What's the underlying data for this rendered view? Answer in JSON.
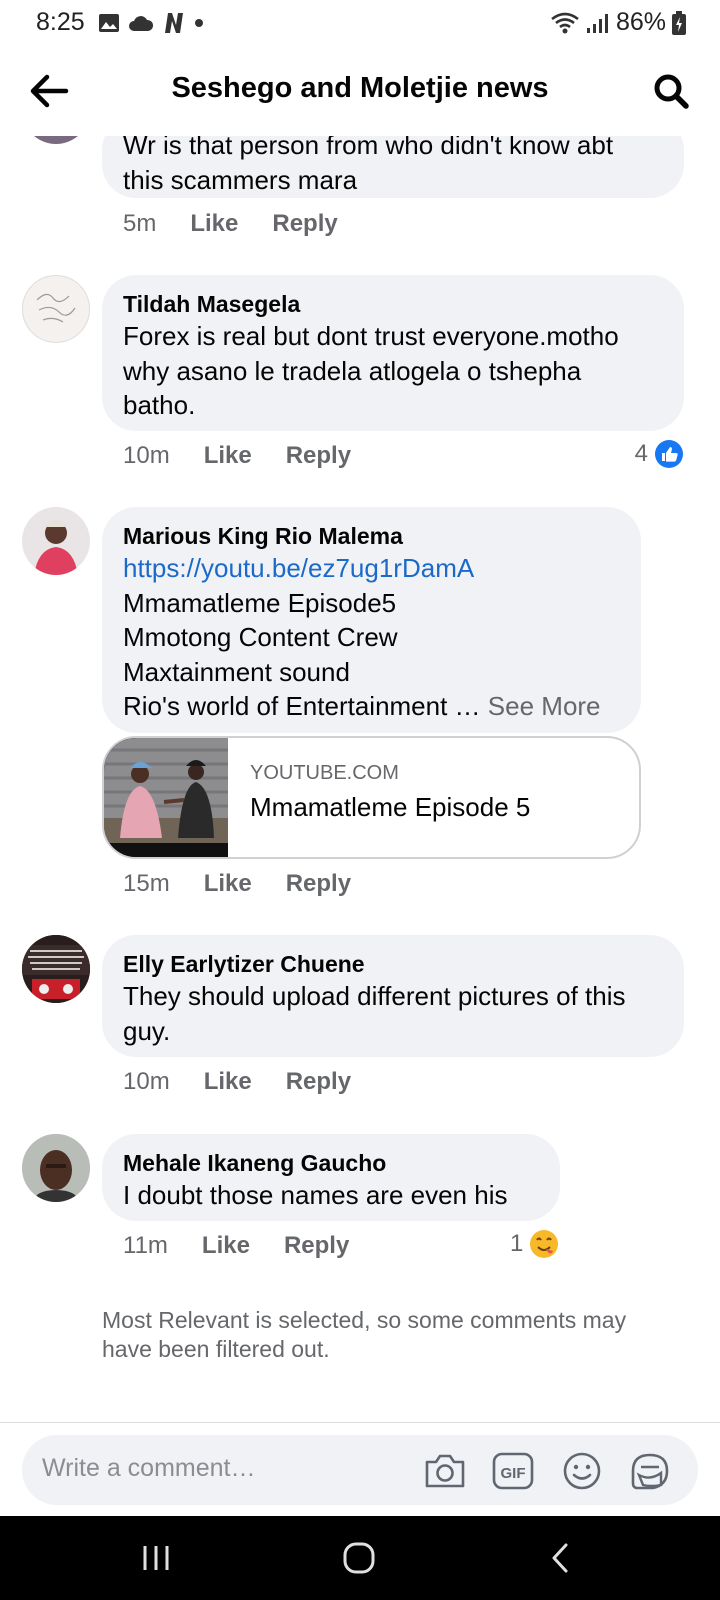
{
  "status_bar": {
    "time": "8:25",
    "battery": "86%"
  },
  "header": {
    "title": "Seshego and Moletjie news"
  },
  "comments": [
    {
      "author": "",
      "text": "Wr is that person from who didn't know abt\nthis scammers mara",
      "time": "5m",
      "like_label": "Like",
      "reply_label": "Reply"
    },
    {
      "author": "Tildah Masegela",
      "text": "Forex is real but dont trust everyone.motho\nwhy asano le tradela atlogela o tshepha\nbatho.",
      "time": "10m",
      "like_label": "Like",
      "reply_label": "Reply",
      "reaction_count": "4",
      "reaction_icon": "like-reaction-icon"
    },
    {
      "author": "Marious King Rio Malema",
      "link": "https://youtu.be/ez7ug1rDamA",
      "text": "Mmamatleme Episode5\nMmotong Content Crew\nMaxtainment sound\nRio's world of Entertainment …",
      "see_more": "See More",
      "link_card": {
        "domain": "YOUTUBE.COM",
        "title": "Mmamatleme Episode 5"
      },
      "time": "15m",
      "like_label": "Like",
      "reply_label": "Reply"
    },
    {
      "author": "Elly Earlytizer Chuene",
      "text": "They should upload different pictures of this\nguy.",
      "time": "10m",
      "like_label": "Like",
      "reply_label": "Reply"
    },
    {
      "author": "Mehale Ikaneng Gaucho",
      "text": "I doubt those names are even his",
      "time": "11m",
      "like_label": "Like",
      "reply_label": "Reply",
      "reaction_count": "1",
      "reaction_icon": "yum-emoji-reaction-icon"
    }
  ],
  "filter_note": "Most Relevant is selected, so some comments may have been filtered out.",
  "composer": {
    "placeholder": "Write a comment…",
    "gif_label": "GIF"
  },
  "colors": {
    "bubble": "#f0f2f5",
    "link": "#1b6ac9",
    "secondary_text": "#65676b",
    "like_blue": "#1877f2"
  }
}
